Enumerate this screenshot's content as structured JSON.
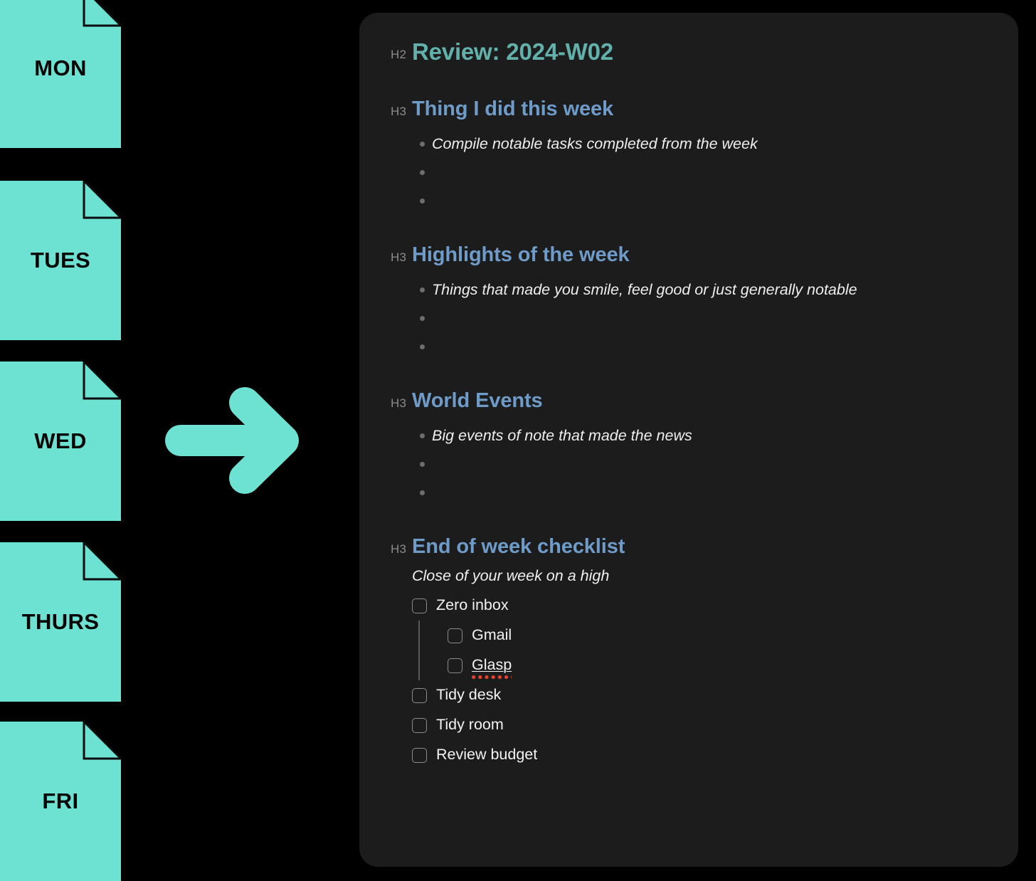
{
  "colors": {
    "accent_teal": "#6EE2D2",
    "panel_bg": "#1C1C1C",
    "page_bg": "#000000",
    "h2_color": "#62B0AB",
    "h3_color": "#6F9BC9",
    "tag_color": "#8C8C8C",
    "spellcheck_red": "#E8402E"
  },
  "day_cards": [
    {
      "label": "MON",
      "icon": "document-icon"
    },
    {
      "label": "TUES",
      "icon": "document-icon"
    },
    {
      "label": "WED",
      "icon": "document-icon"
    },
    {
      "label": "THURS",
      "icon": "document-icon"
    },
    {
      "label": "FRI",
      "icon": "document-icon"
    }
  ],
  "arrow": {
    "icon": "arrow-right-icon",
    "direction": "right"
  },
  "note": {
    "heading": {
      "tag": "H2",
      "text": "Review: 2024-W02"
    },
    "sections": [
      {
        "tag": "H3",
        "title": "Thing I did this week",
        "bullets": [
          "Compile notable tasks completed from the week",
          "",
          ""
        ]
      },
      {
        "tag": "H3",
        "title": "Highlights of the week",
        "bullets": [
          "Things that made you smile, feel good or just generally notable",
          "",
          ""
        ]
      },
      {
        "tag": "H3",
        "title": "World Events",
        "bullets": [
          "Big events of note that made the news",
          "",
          ""
        ]
      }
    ],
    "checklist_section": {
      "tag": "H3",
      "title": "End of week checklist",
      "subtitle": "Close of your week on a high",
      "items": [
        {
          "label": "Zero inbox",
          "checked": false,
          "nested": false,
          "misspelled": false
        },
        {
          "label": "Gmail",
          "checked": false,
          "nested": true,
          "misspelled": false
        },
        {
          "label": "Glasp",
          "checked": false,
          "nested": true,
          "misspelled": true
        },
        {
          "label": "Tidy desk",
          "checked": false,
          "nested": false,
          "misspelled": false
        },
        {
          "label": "Tidy room",
          "checked": false,
          "nested": false,
          "misspelled": false
        },
        {
          "label": "Review budget",
          "checked": false,
          "nested": false,
          "misspelled": false
        }
      ]
    }
  }
}
